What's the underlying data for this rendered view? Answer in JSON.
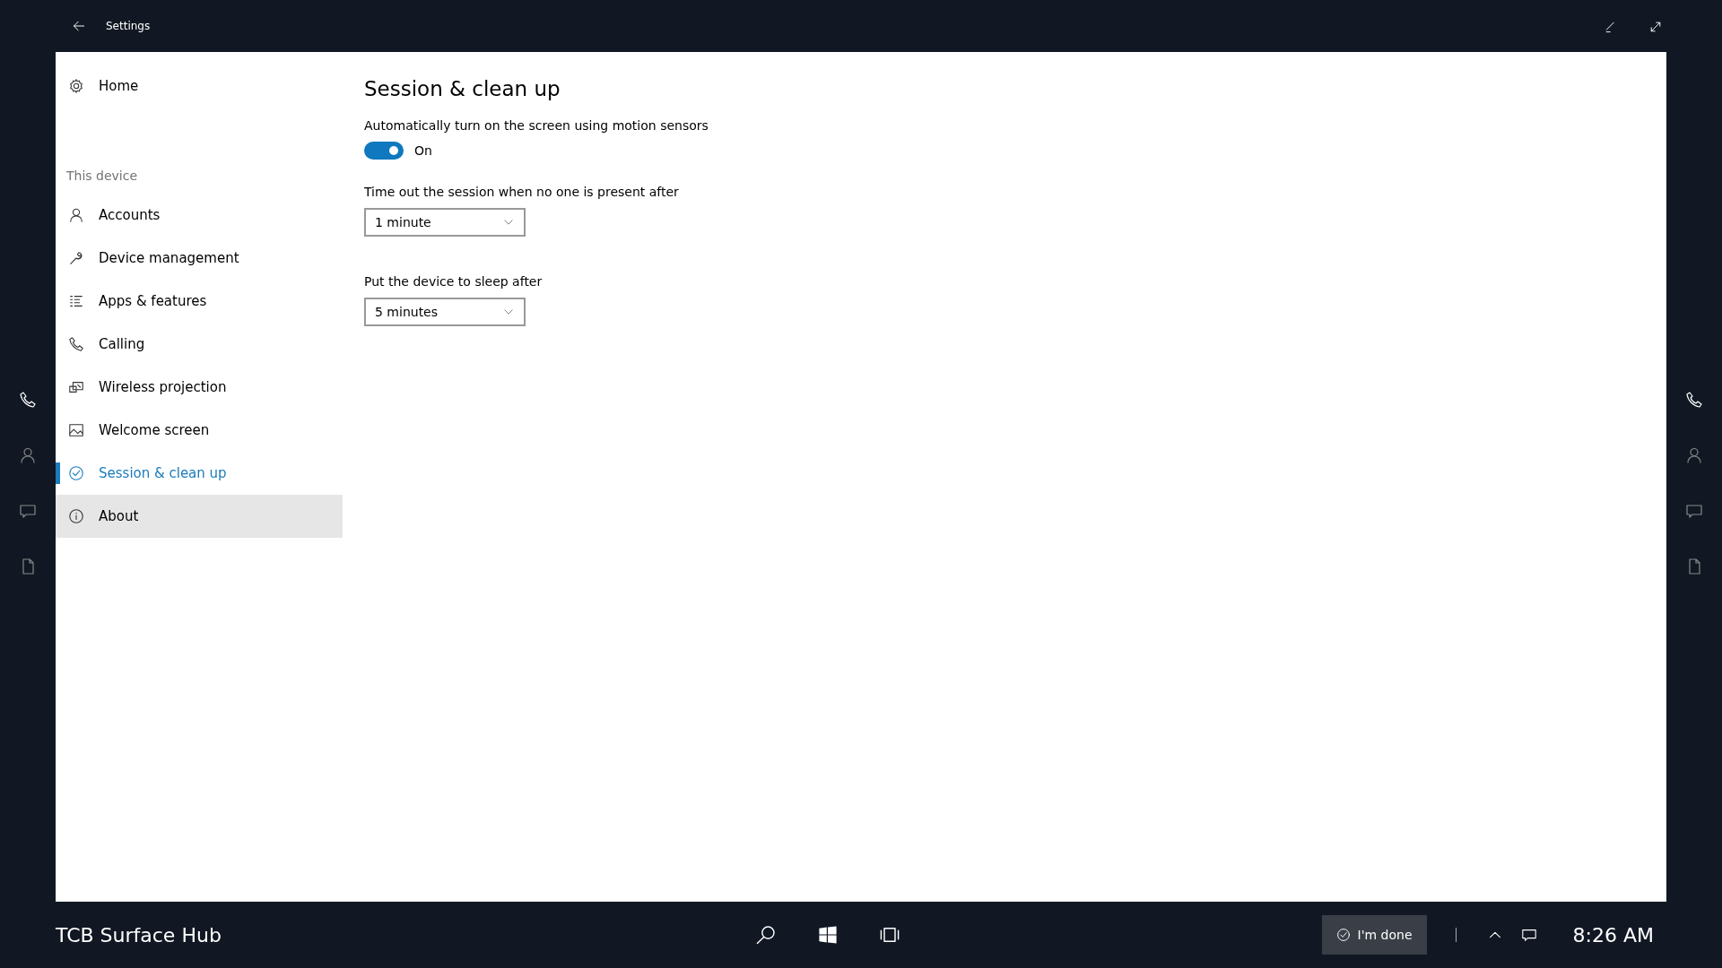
{
  "window": {
    "title": "Settings"
  },
  "sidebar": {
    "home": {
      "label": "Home"
    },
    "section": "This device",
    "items": [
      {
        "label": "Accounts",
        "selected": false,
        "hovered": false
      },
      {
        "label": "Device management",
        "selected": false,
        "hovered": false
      },
      {
        "label": "Apps & features",
        "selected": false,
        "hovered": false
      },
      {
        "label": "Calling",
        "selected": false,
        "hovered": false
      },
      {
        "label": "Wireless projection",
        "selected": false,
        "hovered": false
      },
      {
        "label": "Welcome screen",
        "selected": false,
        "hovered": false
      },
      {
        "label": "Session & clean up",
        "selected": true,
        "hovered": false
      },
      {
        "label": "About",
        "selected": false,
        "hovered": true
      }
    ]
  },
  "page": {
    "title": "Session & clean up",
    "settings": [
      {
        "kind": "toggle",
        "label": "Automatically turn on the screen using motion sensors",
        "on": true,
        "state_label": "On"
      },
      {
        "kind": "dropdown",
        "label": "Time out the session when no one is present after",
        "value": "1 minute"
      },
      {
        "kind": "dropdown",
        "label": "Put the device to sleep after",
        "value": "5 minutes"
      }
    ]
  },
  "taskbar": {
    "device_name": "TCB Surface Hub",
    "done_button": "I'm done",
    "clock": "8:26 AM"
  }
}
